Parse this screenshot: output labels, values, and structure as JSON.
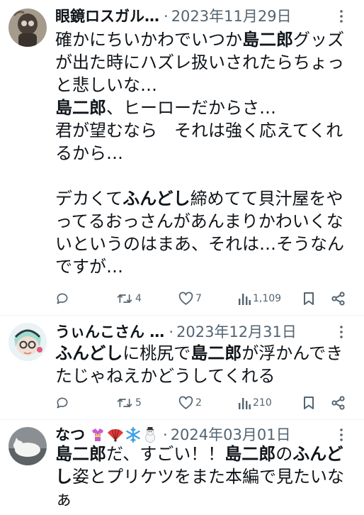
{
  "posts": [
    {
      "name": "眼鏡ロスガル…",
      "separator": "·",
      "date": "2023年11月29日",
      "segments": [
        {
          "t": "確かにちいかわでいつか",
          "b": false
        },
        {
          "t": "島二郎",
          "b": true
        },
        {
          "t": "グッズ\nが出た時にハズレ扱いされたらちょっ\nと悲しいな…\n",
          "b": false
        },
        {
          "t": "島二郎",
          "b": true
        },
        {
          "t": "、ヒーローだからさ…\n君が望むなら　それは強く応えてくれ\nるから…\n\nデカくて",
          "b": false
        },
        {
          "t": "ふんどし",
          "b": true
        },
        {
          "t": "締めてて貝汁屋をや\nってるおっさんがあんまりかわいくな\nいというのはまあ、それは…そうなん\nですが…",
          "b": false
        }
      ],
      "stats": {
        "replies": "",
        "reposts": "4",
        "likes": "7",
        "views": "1,109"
      }
    },
    {
      "name": "うぃんこさん …",
      "separator": "·",
      "date": "2023年12月31日",
      "segments": [
        {
          "t": "ふんどし",
          "b": true
        },
        {
          "t": "に桃尻で",
          "b": false
        },
        {
          "t": "島二郎",
          "b": true
        },
        {
          "t": "が浮かんでき\nたじゃねえかどうしてくれる",
          "b": false
        }
      ],
      "stats": {
        "replies": "",
        "reposts": "5",
        "likes": "2",
        "views": "210"
      }
    },
    {
      "name": "なつ",
      "name_emojis": [
        "kimono-emoji",
        "fan-emoji",
        "snowflake-emoji",
        "snowman-emoji"
      ],
      "separator": "·",
      "date": "2024年03月01日",
      "segments": [
        {
          "t": "島二郎",
          "b": true
        },
        {
          "t": "だ、すごい！！",
          "b": false
        },
        {
          "t": "島二郎",
          "b": true
        },
        {
          "t": "の",
          "b": false
        },
        {
          "t": "ふんど\nし",
          "b": true
        },
        {
          "t": "姿とプリケツをまた本編で見たいな\nぁ",
          "b": false
        }
      ]
    }
  ],
  "colors": {
    "text": "#0f1419",
    "muted": "#536471",
    "separator": "#eff3f4",
    "background": "#ffffff"
  }
}
